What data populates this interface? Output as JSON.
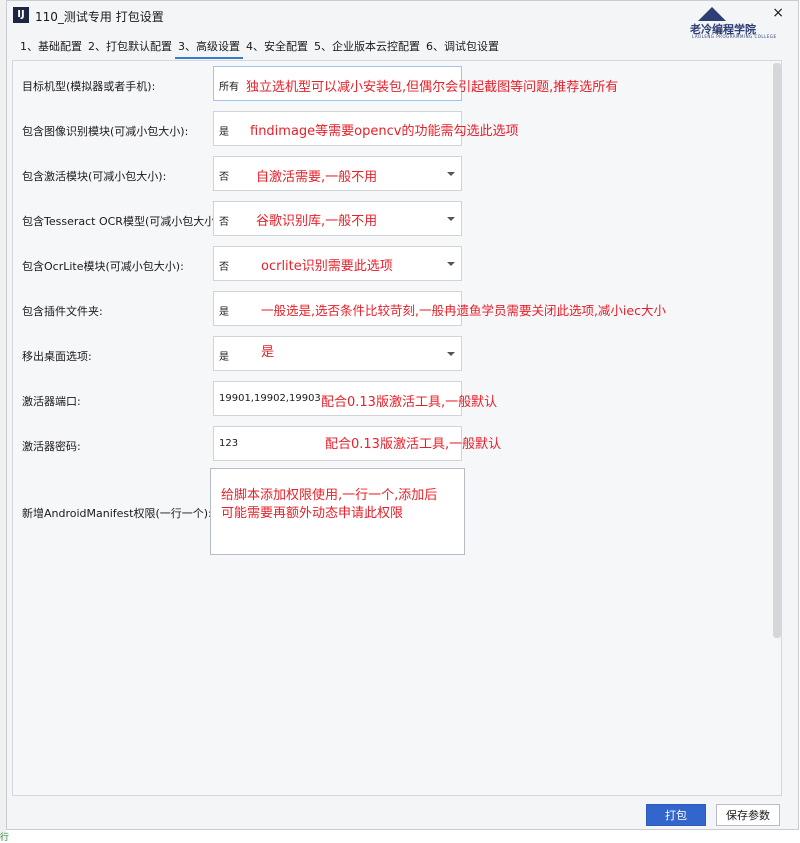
{
  "window": {
    "title": "110_测试专用 打包设置",
    "close_glyph": "×",
    "app_icon_glyph": "IJ"
  },
  "logo": {
    "name": "老冷编程学院",
    "subtitle": "LAOLENG PROGRAMMING COLLEGE"
  },
  "tabs": [
    {
      "label": "1、基础配置"
    },
    {
      "label": "2、打包默认配置"
    },
    {
      "label": "3、高级设置"
    },
    {
      "label": "4、安全配置"
    },
    {
      "label": "5、企业版本云控配置"
    },
    {
      "label": "6、调试包设置"
    }
  ],
  "active_tab": "3、高级设置",
  "rows": [
    {
      "label": "目标机型(模拟器或者手机):",
      "value": "所有",
      "dropdown": true,
      "note": "独立选机型可以减小安装包,但偶尔会引起截图等问题,推荐选所有"
    },
    {
      "label": "包含图像识别模块(可减小包大小):",
      "value": "是",
      "dropdown": true,
      "note": "findimage等需要opencv的功能需勾选此选项"
    },
    {
      "label": "包含激活模块(可减小包大小):",
      "value": "否",
      "dropdown": true,
      "note": "自激活需要,一般不用"
    },
    {
      "label": "包含Tesseract OCR模型(可减小包大小):",
      "value": "否",
      "dropdown": true,
      "note": "谷歌识别库,一般不用"
    },
    {
      "label": "包含OcrLite模块(可减小包大小):",
      "value": "否",
      "dropdown": true,
      "note": "ocrlite识别需要此选项"
    },
    {
      "label": "包含插件文件夹:",
      "value": "是",
      "dropdown": true,
      "note": "一般选是,选否条件比较苛刻,一般冉遗鱼学员需要关闭此选项,减小iec大小"
    },
    {
      "label": "移出桌面选项:",
      "value": "是",
      "dropdown": true,
      "note": "是"
    },
    {
      "label": "激活器端口:",
      "value": "19901,19902,19903",
      "dropdown": false,
      "note": "配合0.13版激活工具,一般默认"
    },
    {
      "label": "激活器密码:",
      "value": "123",
      "dropdown": false,
      "note": "配合0.13版激活工具,一般默认"
    }
  ],
  "permissions": {
    "label": "新增AndroidManifest权限(一行一个):",
    "note_line1": "给脚本添加权限使用,一行一个,添加后",
    "note_line2": "可能需要再额外动态申请此权限"
  },
  "buttons": {
    "build": "打包",
    "save": "保存参数"
  },
  "colors": {
    "annotation": "#e8202a",
    "primary_button": "#3366cc",
    "active_tab_underline": "#3a78c8"
  }
}
